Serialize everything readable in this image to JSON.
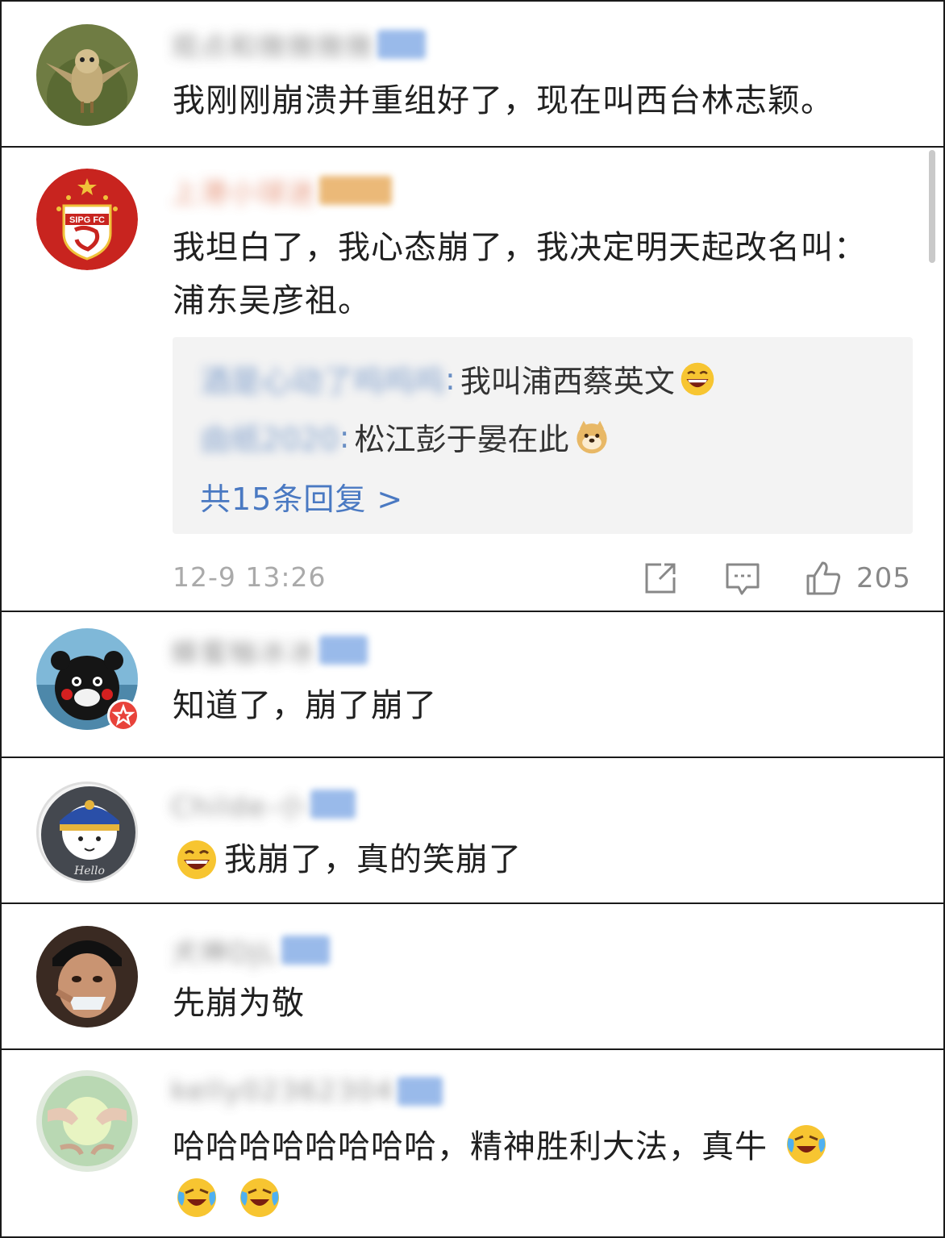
{
  "comments": [
    {
      "username": "观点和微微微微",
      "avatar": "owl-avatar",
      "text": "我刚刚崩溃并重组好了，现在叫西台林志颖。"
    },
    {
      "username": "上港小球迷",
      "avatar": "sipg-fc-logo-avatar",
      "text": "我坦白了，我心态崩了，我决定明天起改名叫：浦东吴彦祖。",
      "logo_text": "SIPG FC",
      "replies": [
        {
          "user": "酒是心动了呜呜呜",
          "text": "我叫浦西蔡英文",
          "emoji": "laughing-emoji"
        },
        {
          "user": "由纸2020",
          "text": "松江彭于晏在此",
          "emoji": "doge-emoji"
        }
      ],
      "more_replies": "共15条回复 >",
      "timestamp": "12-9 13:26",
      "like_count": "205",
      "actions": [
        "share-icon",
        "comment-icon",
        "like-icon"
      ]
    },
    {
      "username": "蜂蜜柚冰冰",
      "avatar": "kumamon-avatar",
      "text": "知道了，崩了崩了"
    },
    {
      "username": "Childe-小",
      "avatar": "cartoon-boy-avatar",
      "text": "我崩了，真的笑崩了",
      "avatar_text": "Hello",
      "emoji": "laughing-emoji"
    },
    {
      "username": "犬神DJL",
      "avatar": "man-drinking-avatar",
      "text": "先崩为敬"
    },
    {
      "username": "kelly02362304",
      "avatar": "hands-avatar",
      "text": "哈哈哈哈哈哈哈哈，精神胜利大法，真牛",
      "emoji": "crying-laughing-emoji"
    }
  ],
  "colors": {
    "accent_blue": "#4a79c2",
    "border": "#1a1a1a",
    "reply_bg": "#f3f3f3",
    "meta_gray": "#aaaaaa"
  }
}
